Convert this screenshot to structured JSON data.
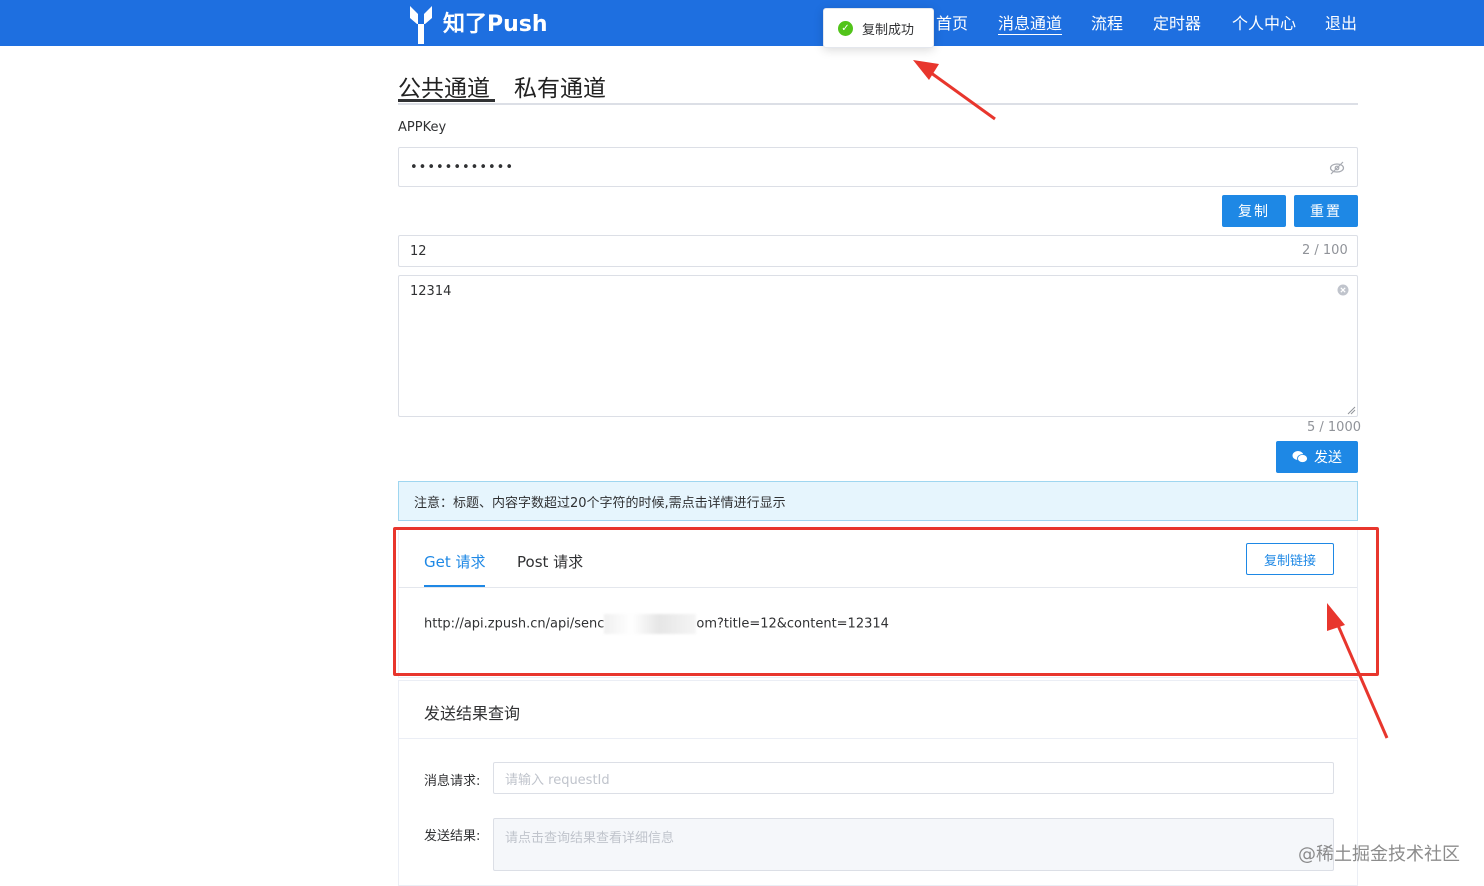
{
  "header": {
    "brand": "知了Push",
    "nav": [
      "首页",
      "消息通道",
      "流程",
      "定时器",
      "个人中心",
      "退出"
    ],
    "active_nav": "消息通道",
    "background_color": "#1e6fe0"
  },
  "toast": {
    "icon": "check-circle-icon",
    "message": "复制成功"
  },
  "tabs": {
    "items": [
      "公共通道",
      "私有通道"
    ],
    "active": "公共通道"
  },
  "appkey": {
    "label": "APPKey",
    "value": "••••••••••••",
    "toggle_icon": "eye-off-icon",
    "copy_button": "复制",
    "reset_button": "重置"
  },
  "title_field": {
    "value": "12",
    "counter": "2 / 100"
  },
  "content_field": {
    "value": "12314",
    "clear_icon": "clear-circle-icon",
    "counter": "5 / 1000"
  },
  "send_button": {
    "label": "发送",
    "icon": "wechat-icon"
  },
  "notice": "注意：标题、内容字数超过20个字符的时候,需点击详情进行显示",
  "request": {
    "tabs": [
      "Get 请求",
      "Post 请求"
    ],
    "active": "Get 请求",
    "copy_link_button": "复制链接",
    "url_prefix": "http://api.zpush.cn/api/senc",
    "url_suffix": "om?title=12&content=12314"
  },
  "result": {
    "title": "发送结果查询",
    "request_label": "消息请求:",
    "request_placeholder": "请输入 requestId",
    "result_label": "发送结果:",
    "result_placeholder": "请点击查询结果查看详细信息"
  },
  "watermark": "@稀土掘金技术社区",
  "colors": {
    "primary": "#1e88e5",
    "annotation": "#e8362d",
    "success": "#52c41a"
  }
}
